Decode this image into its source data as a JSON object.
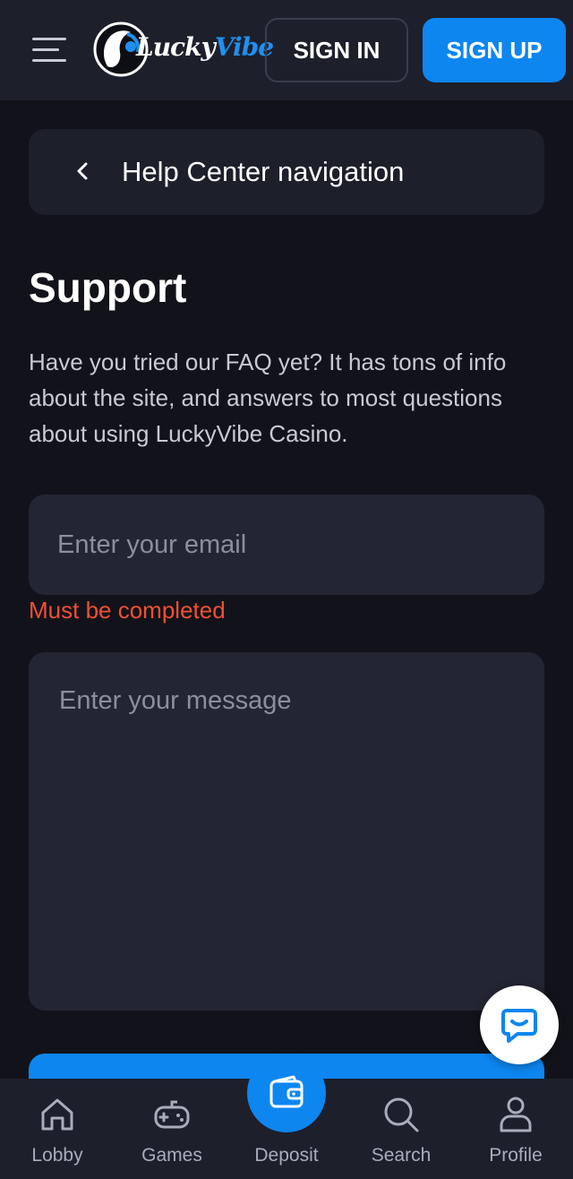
{
  "header": {
    "logo": {
      "brand_first": "Lucky",
      "brand_second": "Vibe"
    },
    "signin_label": "SIGN IN",
    "signup_label": "SIGN UP"
  },
  "help_nav": {
    "label": "Help Center navigation"
  },
  "main": {
    "title": "Support",
    "intro": "Have you tried our FAQ yet? It has tons of info about the site, and answers to most questions about using LuckyVibe Casino.",
    "email": {
      "placeholder": "Enter your email",
      "value": ""
    },
    "email_error": "Must be completed",
    "message": {
      "placeholder": "Enter your message",
      "value": ""
    }
  },
  "bottom_nav": {
    "items": [
      {
        "label": "Lobby",
        "icon": "home-icon"
      },
      {
        "label": "Games",
        "icon": "gamepad-icon"
      },
      {
        "label": "Deposit",
        "icon": "wallet-icon"
      },
      {
        "label": "Search",
        "icon": "search-icon"
      },
      {
        "label": "Profile",
        "icon": "user-icon"
      }
    ]
  },
  "colors": {
    "background": "#12131a",
    "surface": "#1d1f2b",
    "input": "#232533",
    "accent": "#0d86f0",
    "error": "#f05034"
  }
}
